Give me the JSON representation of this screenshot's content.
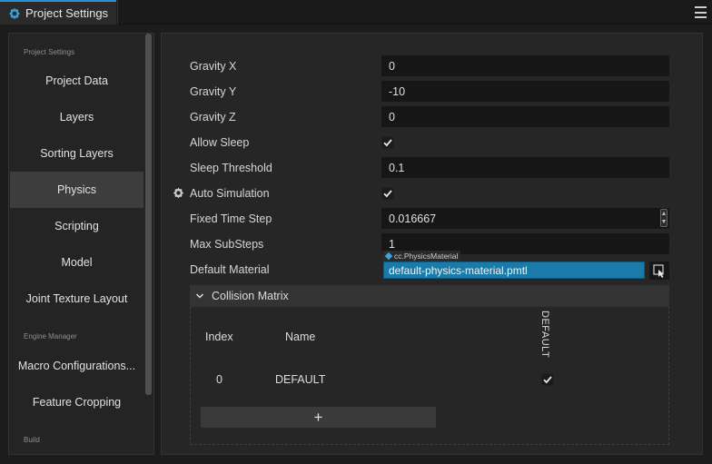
{
  "window": {
    "tab_title": "Project Settings"
  },
  "sidebar": {
    "sections": [
      {
        "label": "Project Settings"
      },
      {
        "label": "Engine Manager"
      },
      {
        "label": "Build"
      }
    ],
    "items": [
      {
        "label": "Project Data"
      },
      {
        "label": "Layers"
      },
      {
        "label": "Sorting Layers"
      },
      {
        "label": "Physics"
      },
      {
        "label": "Scripting"
      },
      {
        "label": "Model"
      },
      {
        "label": "Joint Texture Layout"
      },
      {
        "label": "Macro Configurations..."
      },
      {
        "label": "Feature Cropping"
      }
    ],
    "active_item": "Physics"
  },
  "physics": {
    "gravity_x": {
      "label": "Gravity X",
      "value": "0"
    },
    "gravity_y": {
      "label": "Gravity Y",
      "value": "-10"
    },
    "gravity_z": {
      "label": "Gravity Z",
      "value": "0"
    },
    "allow_sleep": {
      "label": "Allow Sleep",
      "checked": true
    },
    "sleep_threshold": {
      "label": "Sleep Threshold",
      "value": "0.1"
    },
    "auto_simulation": {
      "label": "Auto Simulation",
      "checked": true
    },
    "fixed_time_step": {
      "label": "Fixed Time Step",
      "value": "0.016667"
    },
    "max_substeps": {
      "label": "Max SubSteps",
      "value": "1"
    },
    "default_material": {
      "label": "Default Material",
      "type_tag": "cc.PhysicsMaterial",
      "value": "default-physics-material.pmtl"
    }
  },
  "collision_matrix": {
    "title": "Collision Matrix",
    "col_index": "Index",
    "col_name": "Name",
    "groups": [
      {
        "index": "0",
        "name": "DEFAULT"
      }
    ],
    "column_groups": [
      "DEFAULT"
    ],
    "add_label": "+"
  },
  "colors": {
    "accent": "#2d8ed1",
    "material_field": "#1a7bab",
    "active_item_bg": "#3d3d3d"
  }
}
